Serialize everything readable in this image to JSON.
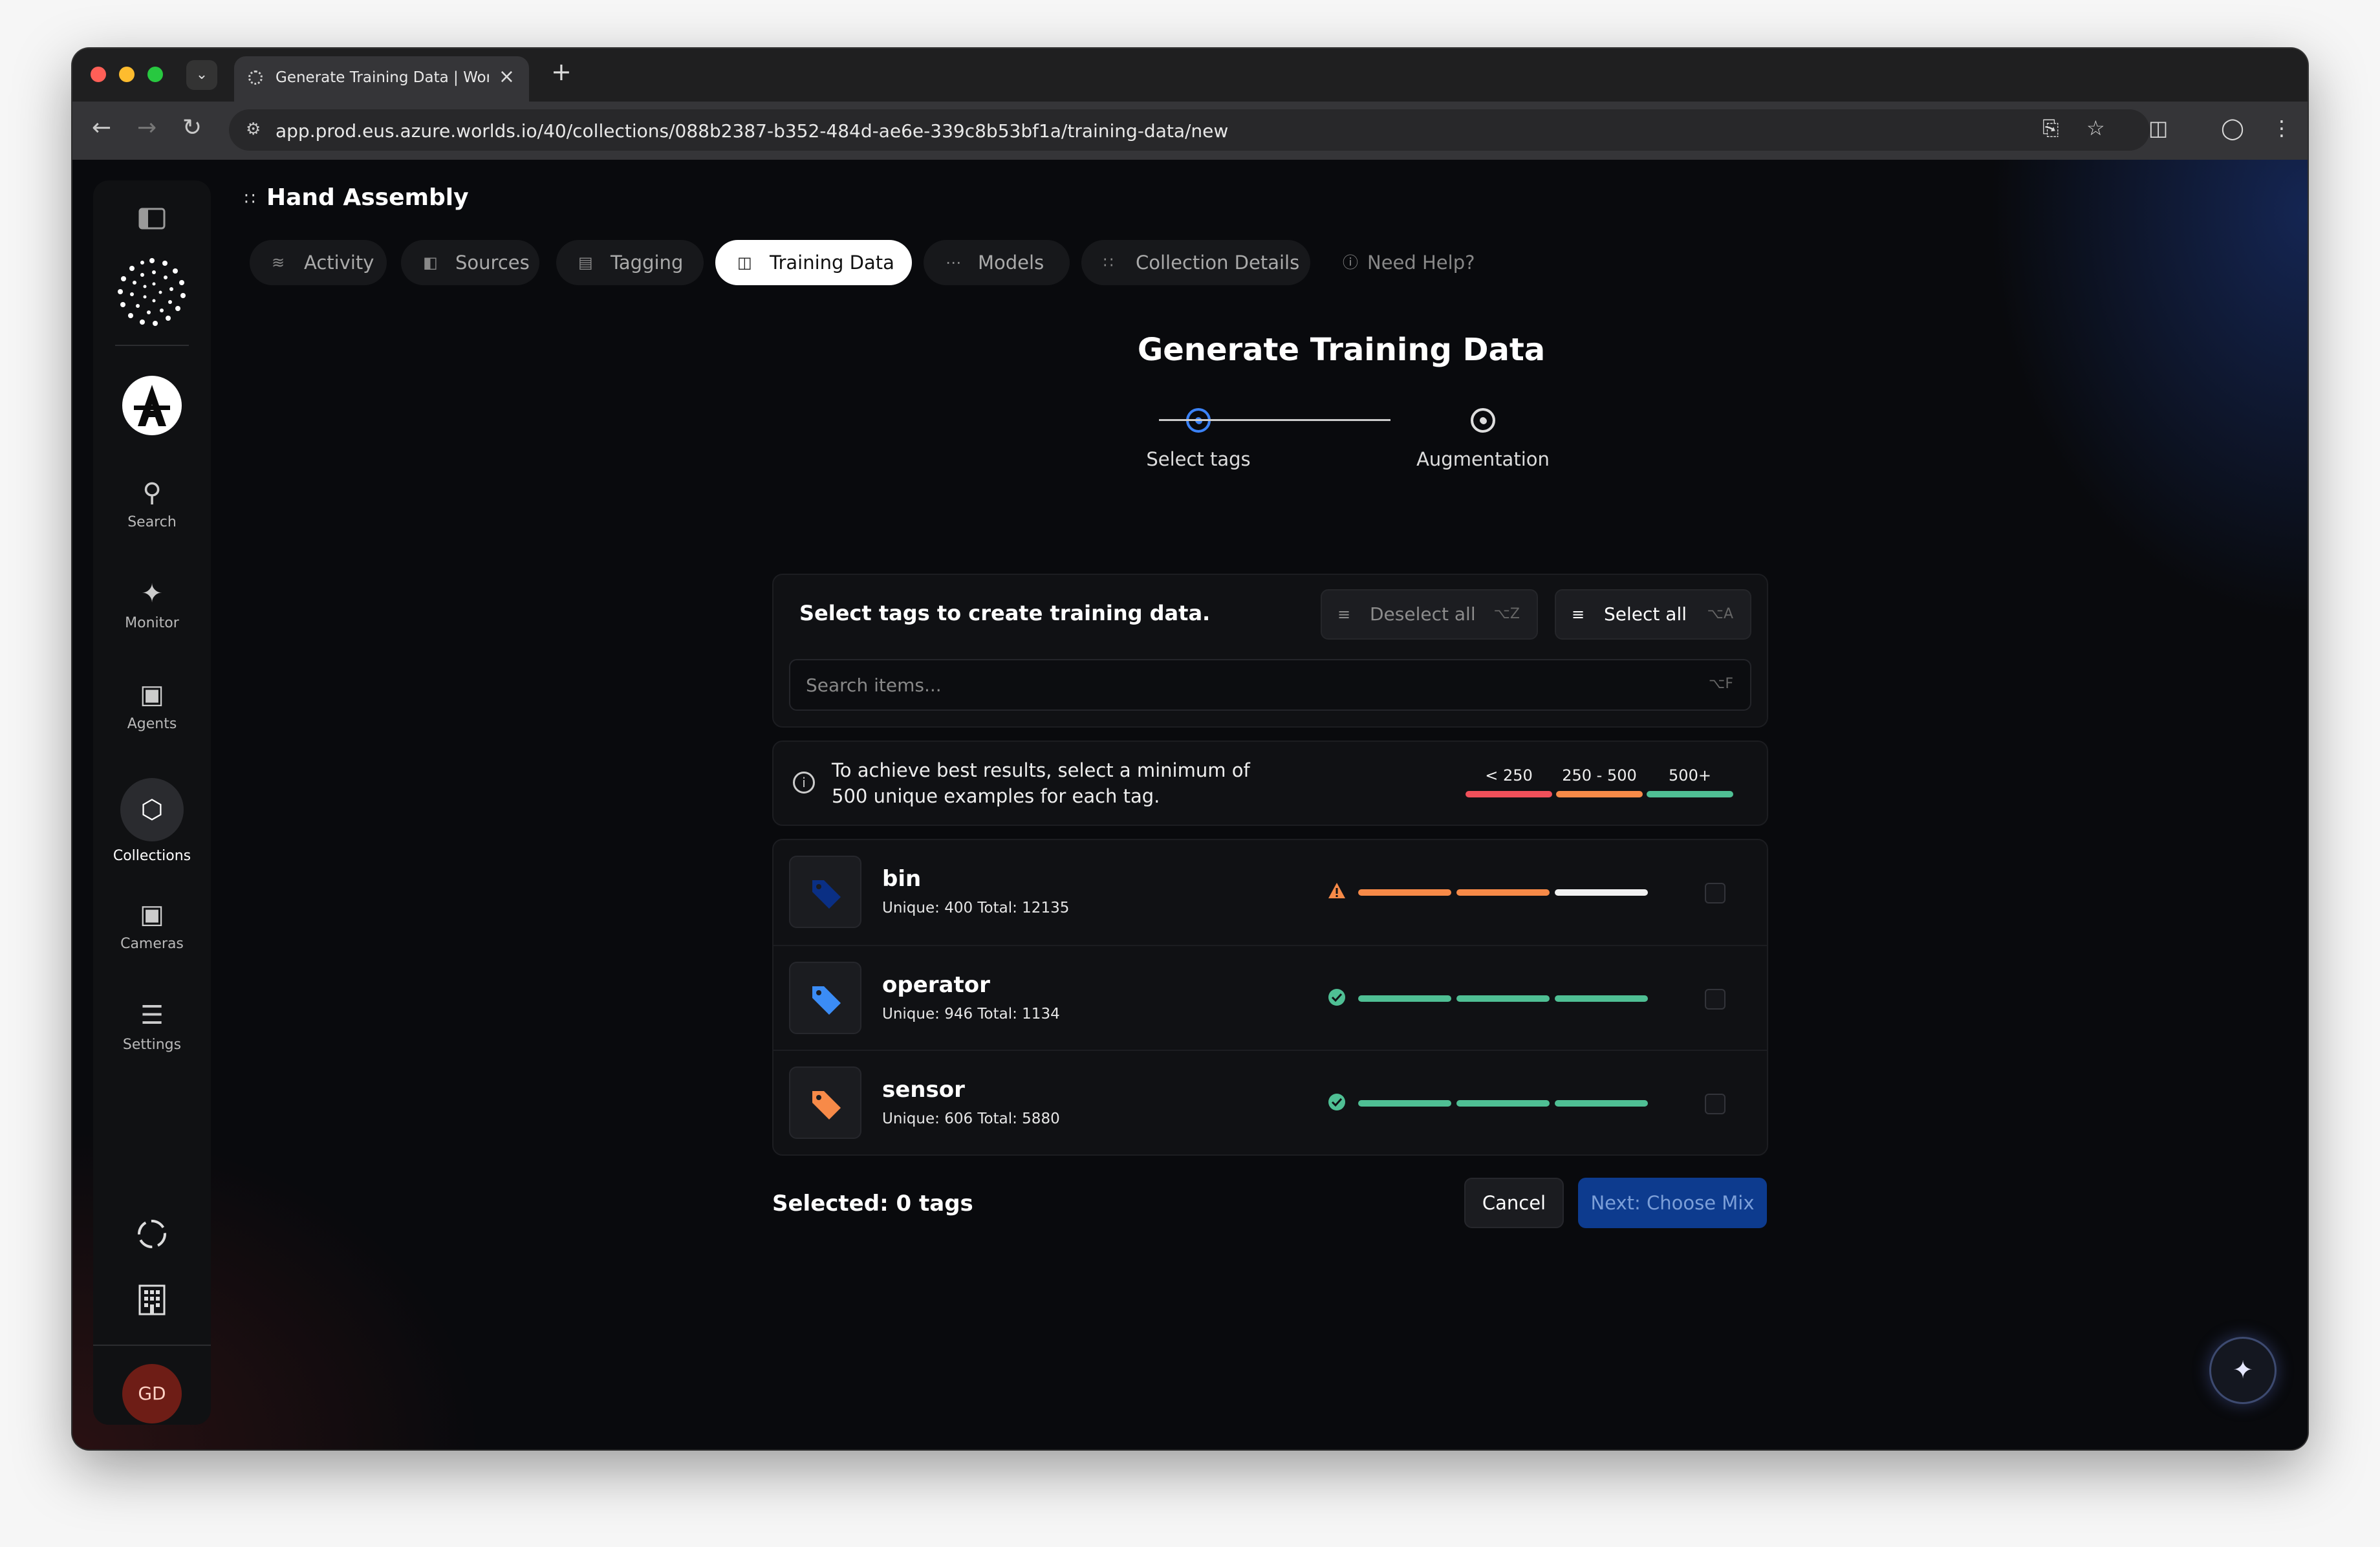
{
  "browser": {
    "tab_title": "Generate Training Data | Worl",
    "url": "app.prod.eus.azure.worlds.io/40/collections/088b2387-b352-484d-ae6e-339c8b53bf1a/training-data/new"
  },
  "sidebar": {
    "items": [
      {
        "label": "Search",
        "icon": "search-icon"
      },
      {
        "label": "Monitor",
        "icon": "monitor-icon"
      },
      {
        "label": "Agents",
        "icon": "robot-icon"
      },
      {
        "label": "Collections",
        "icon": "cube-icon"
      },
      {
        "label": "Cameras",
        "icon": "camera-icon"
      },
      {
        "label": "Settings",
        "icon": "sliders-icon"
      }
    ],
    "avatar_initials": "GD"
  },
  "header": {
    "title": "Hand Assembly",
    "tabs": [
      {
        "label": "Activity"
      },
      {
        "label": "Sources"
      },
      {
        "label": "Tagging"
      },
      {
        "label": "Training Data"
      },
      {
        "label": "Models"
      },
      {
        "label": "Collection Details"
      },
      {
        "label": "Need Help?"
      }
    ],
    "active_tab": "Training Data"
  },
  "main": {
    "title": "Generate Training Data",
    "steps": [
      {
        "label": "Select tags",
        "active": true
      },
      {
        "label": "Augmentation",
        "active": false
      }
    ],
    "select_panel": {
      "label": "Select tags to create training data.",
      "deselect_label": "Deselect all",
      "deselect_shortcut": "⌥Z",
      "select_label": "Select all",
      "select_shortcut": "⌥A",
      "search_placeholder": "Search items...",
      "search_shortcut": "⌥F"
    },
    "info": {
      "text_line1": "To achieve best results, select a minimum of",
      "text_line2": "500 unique examples for each tag.",
      "legend": [
        {
          "label": "< 250",
          "color": "#f0505a"
        },
        {
          "label": "250 - 500",
          "color": "#f78a48"
        },
        {
          "label": "500+",
          "color": "#4fbf94"
        }
      ]
    },
    "tags": [
      {
        "name": "bin",
        "stats": "Unique: 400 Total: 12135",
        "icon_color": "#0a2f84",
        "status": "warning",
        "level": 0.8
      },
      {
        "name": "operator",
        "stats": "Unique: 946 Total: 1134",
        "icon_color": "#3b8cf5",
        "status": "ok",
        "level": 1
      },
      {
        "name": "sensor",
        "stats": "Unique: 606 Total: 5880",
        "icon_color": "#f78a48",
        "status": "ok",
        "level": 1
      }
    ],
    "selected_label": "Selected: 0 tags",
    "cancel_label": "Cancel",
    "next_label": "Next: Choose Mix"
  }
}
